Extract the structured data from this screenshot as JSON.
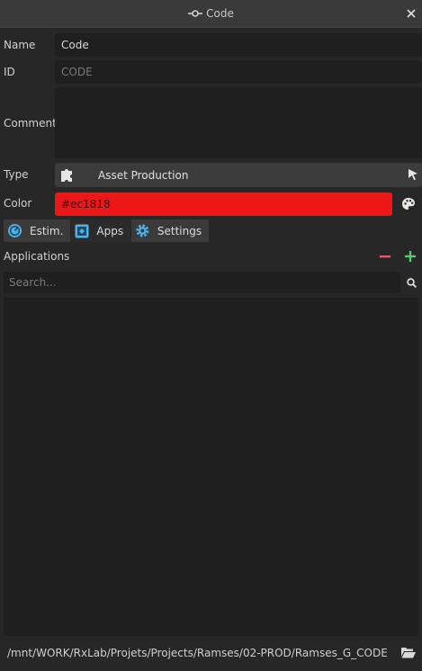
{
  "window": {
    "title": "Code",
    "close_icon": "close-icon"
  },
  "form": {
    "name_label": "Name",
    "name_value": "Code",
    "id_label": "ID",
    "id_placeholder": "CODE",
    "comment_label": "Comment",
    "comment_value": "",
    "type_label": "Type",
    "type_value": "Asset Production",
    "color_label": "Color",
    "color_value": "#ec1818"
  },
  "tabs": [
    {
      "label": "Estim.",
      "icon": "estimation-gauge-icon"
    },
    {
      "label": "Apps",
      "icon": "apps-icon"
    },
    {
      "label": "Settings",
      "icon": "gear-icon"
    }
  ],
  "applications": {
    "title": "Applications",
    "search_placeholder": "Search...",
    "items": []
  },
  "footer": {
    "path": "/mnt/WORK/RxLab/Projets/Projects/Ramses/02-PROD/Ramses_G_CODE"
  },
  "colors": {
    "background": "#272727",
    "field": "#1f1f1f",
    "accent_red": "#ec1818",
    "accent_blue": "#4fb3e8",
    "remove": "#e45c6a",
    "add": "#59c86b"
  }
}
